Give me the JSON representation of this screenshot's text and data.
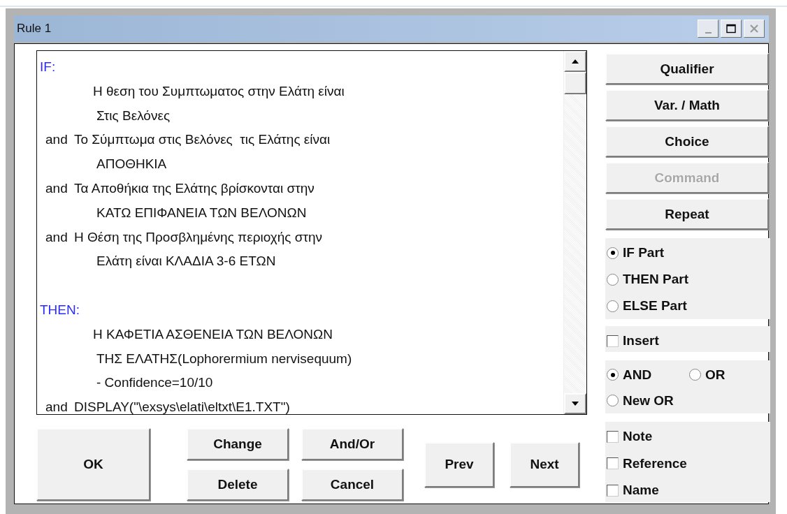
{
  "window": {
    "title": "Rule 1"
  },
  "rule_text": {
    "sections": [
      {
        "heading": "IF:",
        "clauses": [
          {
            "lines": [
              "Η θεση του Συμπτωματος στην Ελάτη είναι",
              "Στις Βελόνες"
            ]
          },
          {
            "connector": "and",
            "lines": [
              "Το Σύμπτωμα στις Βελόνες  τις Ελάτης είναι",
              "ΑΠΟΘΗΚΙΑ"
            ]
          },
          {
            "connector": "and",
            "lines": [
              "Τα Αποθήκια της Ελάτης βρίσκονται στην",
              "ΚΑΤΩ ΕΠΙΦΑΝΕΙΑ ΤΩΝ ΒΕΛΟΝΩΝ"
            ]
          },
          {
            "connector": "and",
            "lines": [
              "Η Θέση της Προσβλημένης περιοχής στην",
              "Ελάτη είναι ΚΛΑΔΙΑ 3-6 ΕΤΩΝ"
            ]
          }
        ]
      },
      {
        "heading": "THEN:",
        "clauses": [
          {
            "lines": [
              "Η ΚΑΦΕΤΙΑ ΑΣΘΕΝΕΙΑ ΤΩΝ ΒΕΛΟΝΩΝ",
              "ΤΗΣ ΕΛΑΤΗΣ(Lophorermium nervisequum)",
              "- Confidence=10/10"
            ]
          },
          {
            "connector": "and",
            "lines": [
              "DISPLAY(\"\\exsys\\elati\\eltxt\\E1.TXT\")"
            ]
          }
        ]
      }
    ]
  },
  "side_buttons": [
    {
      "label": "Qualifier",
      "disabled": false
    },
    {
      "label": "Var. / Math",
      "disabled": false
    },
    {
      "label": "Choice",
      "disabled": false
    },
    {
      "label": "Command",
      "disabled": true
    },
    {
      "label": "Repeat",
      "disabled": false
    }
  ],
  "part_options": [
    {
      "label": "IF Part",
      "selected": true
    },
    {
      "label": "THEN Part",
      "selected": false
    },
    {
      "label": "ELSE Part",
      "selected": false
    }
  ],
  "insert": {
    "label": "Insert",
    "checked": false
  },
  "logic_options": [
    {
      "label": "AND",
      "selected": true
    },
    {
      "label": "OR",
      "selected": false
    },
    {
      "label": "New OR",
      "selected": false
    }
  ],
  "extras": [
    {
      "label": "Note",
      "checked": false
    },
    {
      "label": "Reference",
      "checked": false
    },
    {
      "label": "Name",
      "checked": false
    }
  ],
  "bottom_buttons": {
    "ok": "OK",
    "edit": [
      "Change",
      "Delete"
    ],
    "logic": [
      "And/Or",
      "Cancel"
    ],
    "nav": [
      "Prev",
      "Next"
    ]
  }
}
